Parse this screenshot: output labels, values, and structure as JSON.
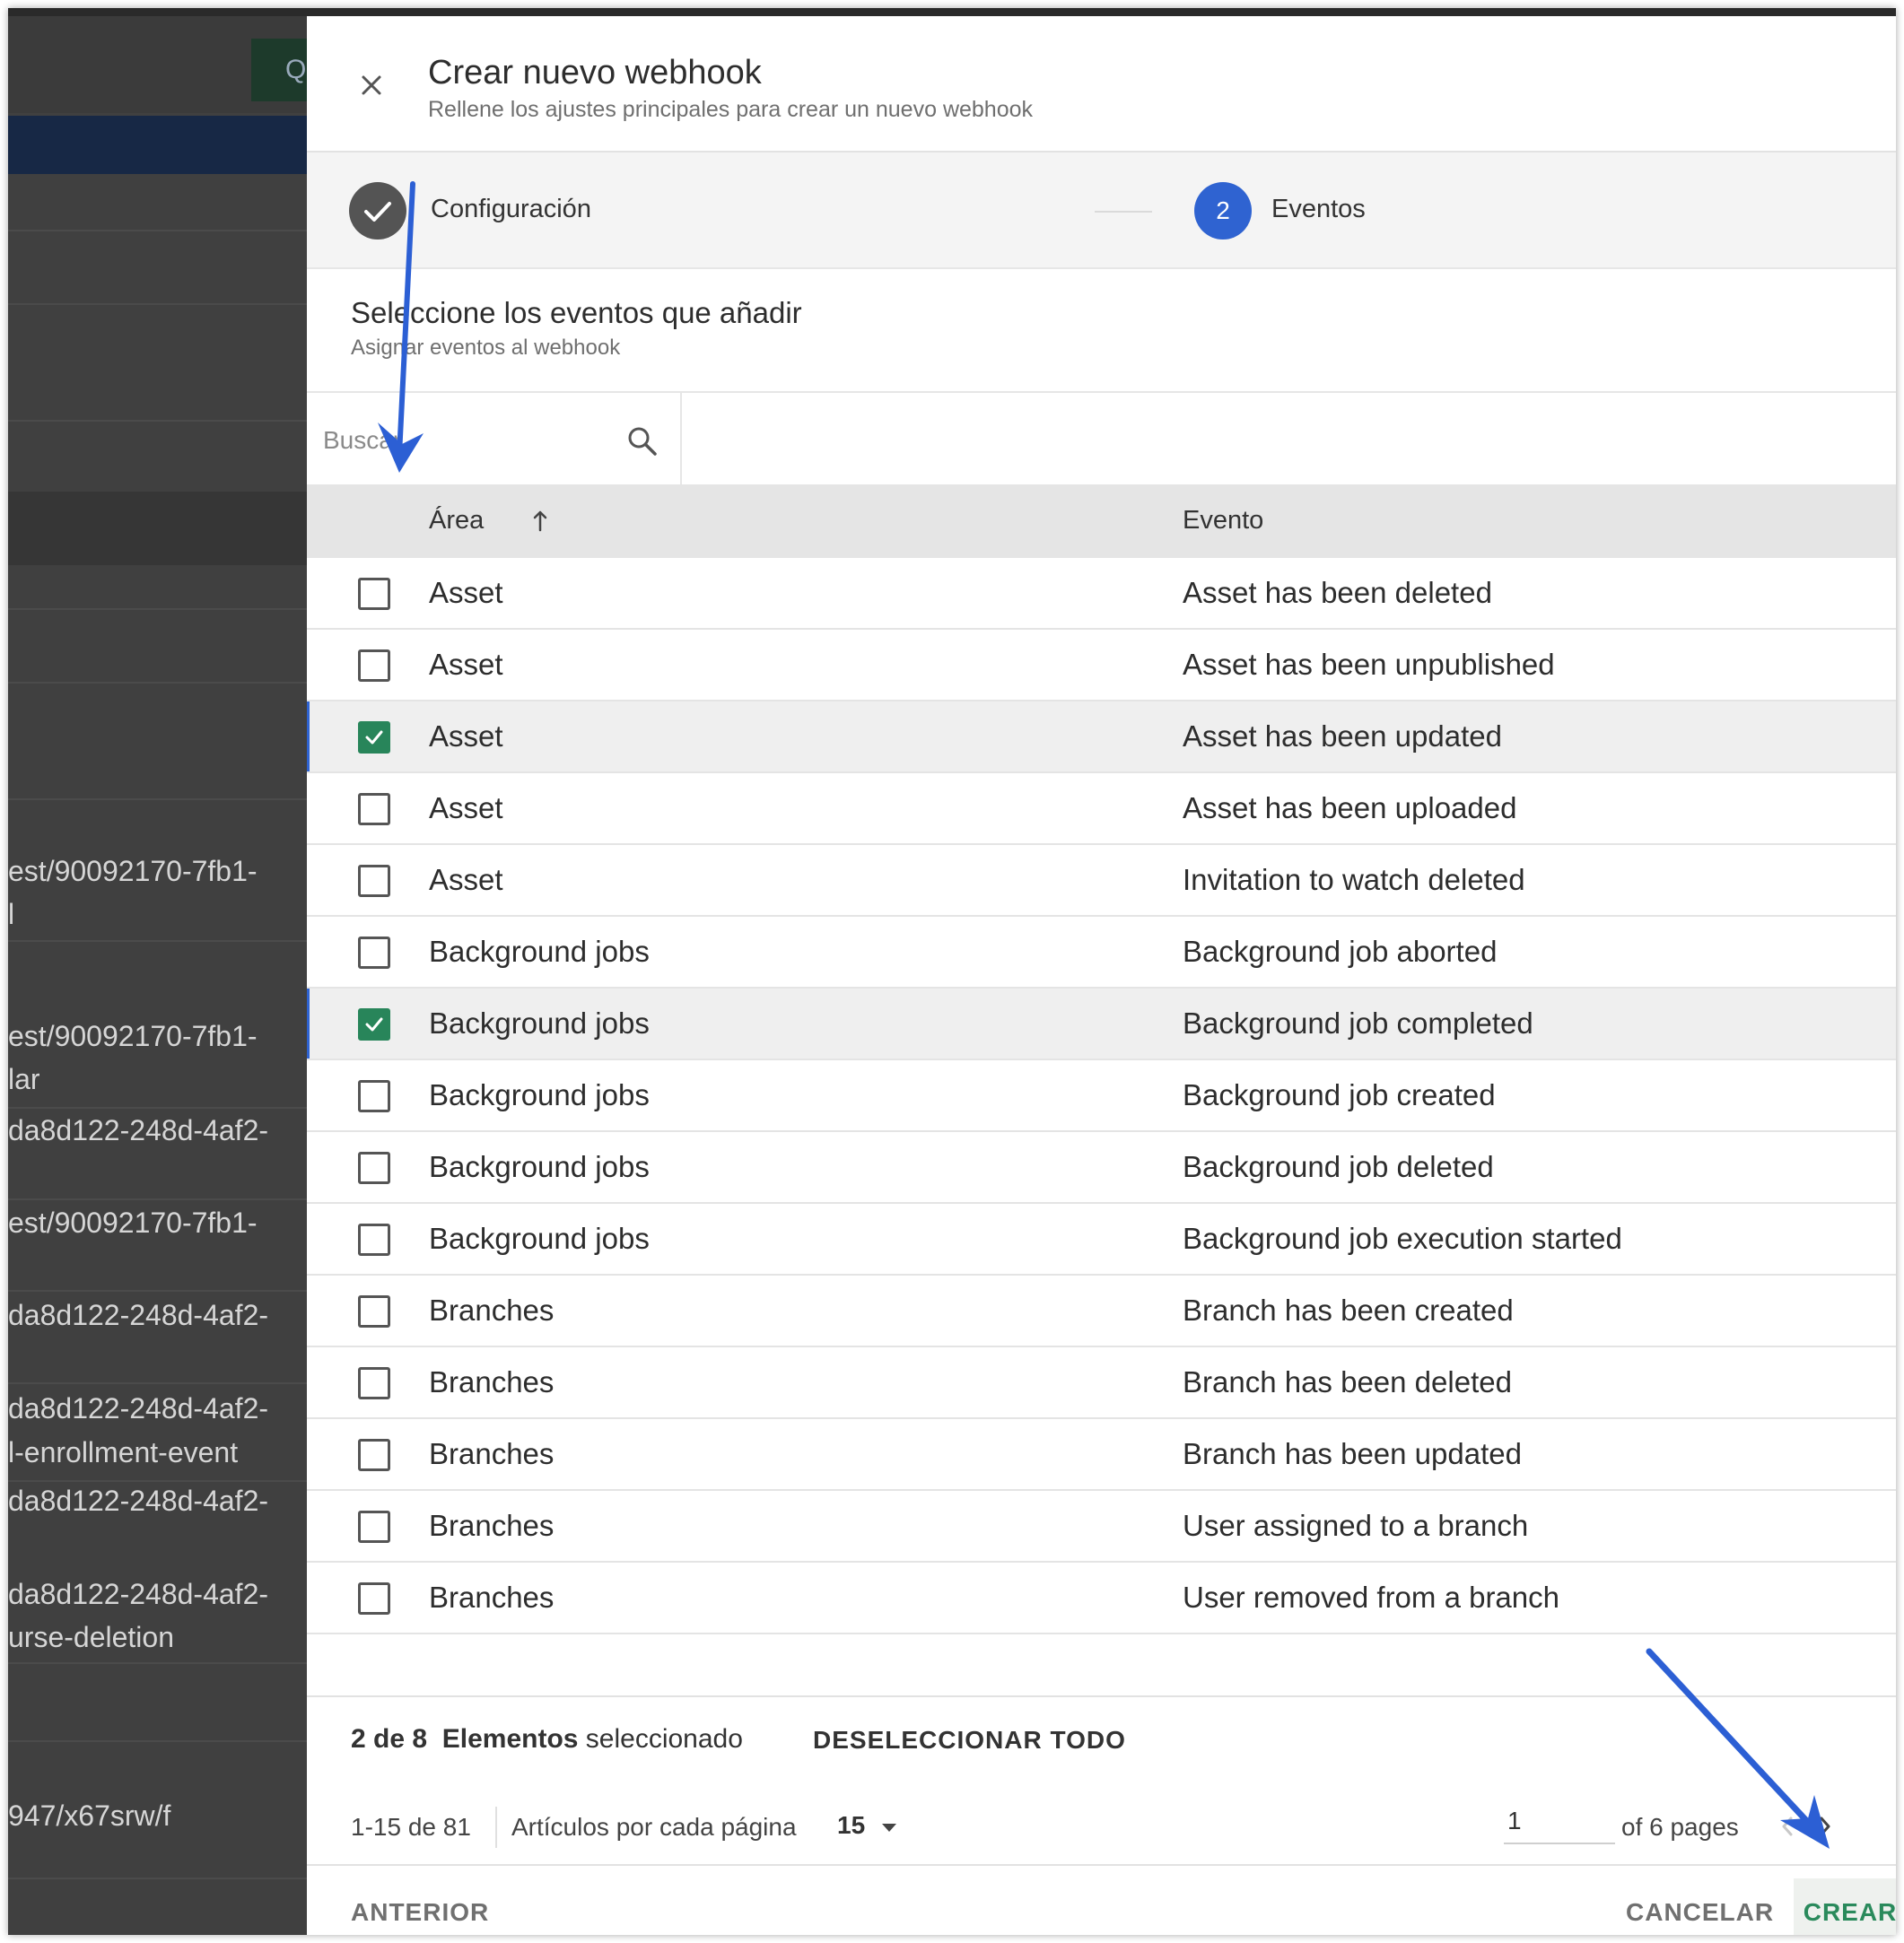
{
  "background_app": {
    "search_glyph": "Q",
    "list_texts": [
      "est/90092170-7fb1-",
      "l",
      "est/90092170-7fb1-",
      "lar",
      "da8d122-248d-4af2-",
      "est/90092170-7fb1-",
      "da8d122-248d-4af2-",
      "da8d122-248d-4af2-",
      "l-enrollment-event",
      "da8d122-248d-4af2-",
      "da8d122-248d-4af2-",
      "urse-deletion",
      "947/x67srw/f"
    ]
  },
  "header": {
    "close_icon": "close-icon",
    "title": "Crear nuevo webhook",
    "subtitle": "Rellene los ajustes principales para crear un nuevo webhook"
  },
  "stepper": {
    "step1": {
      "label": "Configuración",
      "icon": "check-icon",
      "state": "completed"
    },
    "step2": {
      "number": "2",
      "label": "Eventos",
      "state": "active"
    }
  },
  "section": {
    "title": "Seleccione los eventos que añadir",
    "subtitle": "Asignar eventos al webhook"
  },
  "search": {
    "placeholder": "Buscar",
    "icon": "search-icon"
  },
  "table": {
    "columns": {
      "area": "Área",
      "event": "Evento"
    },
    "sort_icon": "arrow-up-icon",
    "rows": [
      {
        "area": "Asset",
        "event": "Asset has been deleted",
        "checked": false
      },
      {
        "area": "Asset",
        "event": "Asset has been unpublished",
        "checked": false
      },
      {
        "area": "Asset",
        "event": "Asset has been updated",
        "checked": true
      },
      {
        "area": "Asset",
        "event": "Asset has been uploaded",
        "checked": false
      },
      {
        "area": "Asset",
        "event": "Invitation to watch deleted",
        "checked": false
      },
      {
        "area": "Background jobs",
        "event": "Background job aborted",
        "checked": false
      },
      {
        "area": "Background jobs",
        "event": "Background job completed",
        "checked": true
      },
      {
        "area": "Background jobs",
        "event": "Background job created",
        "checked": false
      },
      {
        "area": "Background jobs",
        "event": "Background job deleted",
        "checked": false
      },
      {
        "area": "Background jobs",
        "event": "Background job execution started",
        "checked": false
      },
      {
        "area": "Branches",
        "event": "Branch has been created",
        "checked": false
      },
      {
        "area": "Branches",
        "event": "Branch has been deleted",
        "checked": false
      },
      {
        "area": "Branches",
        "event": "Branch has been updated",
        "checked": false
      },
      {
        "area": "Branches",
        "event": "User assigned to a branch",
        "checked": false
      },
      {
        "area": "Branches",
        "event": "User removed from a branch",
        "checked": false
      }
    ]
  },
  "selection": {
    "count": "2 de 8",
    "elements": "Elementos",
    "selected": "seleccionado",
    "deselect_all": "DESELECCIONAR TODO"
  },
  "pagination": {
    "range": "1-15 de 81",
    "per_page_label": "Artículos por cada página",
    "per_page_value": "15",
    "page_value": "1",
    "of_pages": "of 6 pages"
  },
  "actions": {
    "previous": "ANTERIOR",
    "cancel": "CANCELAR",
    "create": "CREAR"
  },
  "colors": {
    "accent_blue": "#2f63d1",
    "check_green": "#28855a",
    "annotation_arrow": "#2c5fd4"
  }
}
